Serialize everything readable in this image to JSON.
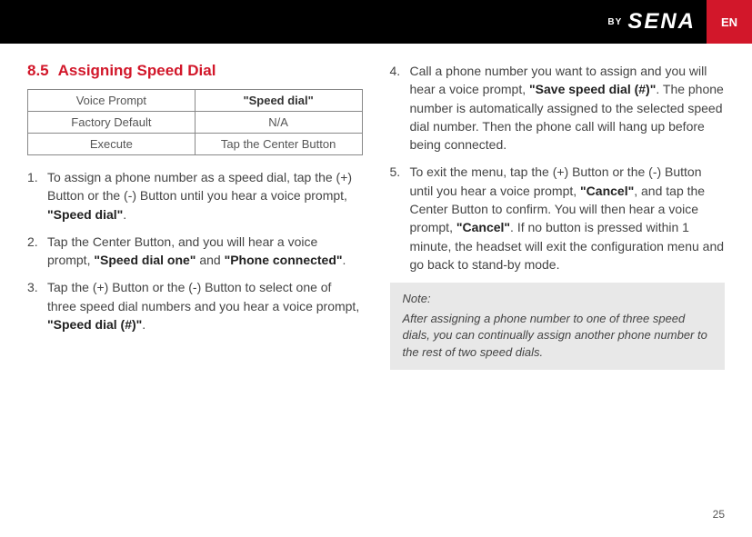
{
  "header": {
    "by": "BY",
    "logo": "SENA",
    "lang": "EN"
  },
  "section": {
    "number": "8.5",
    "title": "Assigning Speed Dial"
  },
  "table": {
    "row1_label": "Voice Prompt",
    "row1_value": "\"Speed dial\"",
    "row2_label": "Factory Default",
    "row2_value": "N/A",
    "row3_label": "Execute",
    "row3_value": "Tap the Center Button"
  },
  "steps_left": {
    "s1a": "To assign a phone number as a speed dial, tap the (+) Button or the (-) Button until you hear a voice prompt, ",
    "s1b": "\"Speed dial\"",
    "s1c": ".",
    "s2a": "Tap the Center Button, and you will hear a voice prompt, ",
    "s2b": "\"Speed dial one\"",
    "s2c": " and ",
    "s2d": "\"Phone connected\"",
    "s2e": ".",
    "s3a": "Tap the (+) Button or the (-) Button to select one of three speed dial numbers and you hear a voice prompt, ",
    "s3b": "\"Speed dial (#)\"",
    "s3c": "."
  },
  "steps_right": {
    "s4a": "Call a phone number you want to assign and you will hear a voice prompt, ",
    "s4b": "\"Save speed dial (#)\"",
    "s4c": ". The phone number is automatically assigned to the selected speed dial number. Then the phone call will hang up before being connected.",
    "s5a": "To exit the menu, tap the (+) Button or the (-) Button until you hear a voice prompt, ",
    "s5b": "\"Cancel\"",
    "s5c": ", and tap the Center Button to confirm. You will then hear a voice prompt, ",
    "s5d": "\"Cancel\"",
    "s5e": ". If no button is pressed within 1 minute, the headset will exit the configuration menu and go back to stand-by mode."
  },
  "note": {
    "title": "Note:",
    "body": "After assigning a phone number to one of three speed dials, you can continually assign another phone number to the rest of two speed dials."
  },
  "page_number": "25"
}
